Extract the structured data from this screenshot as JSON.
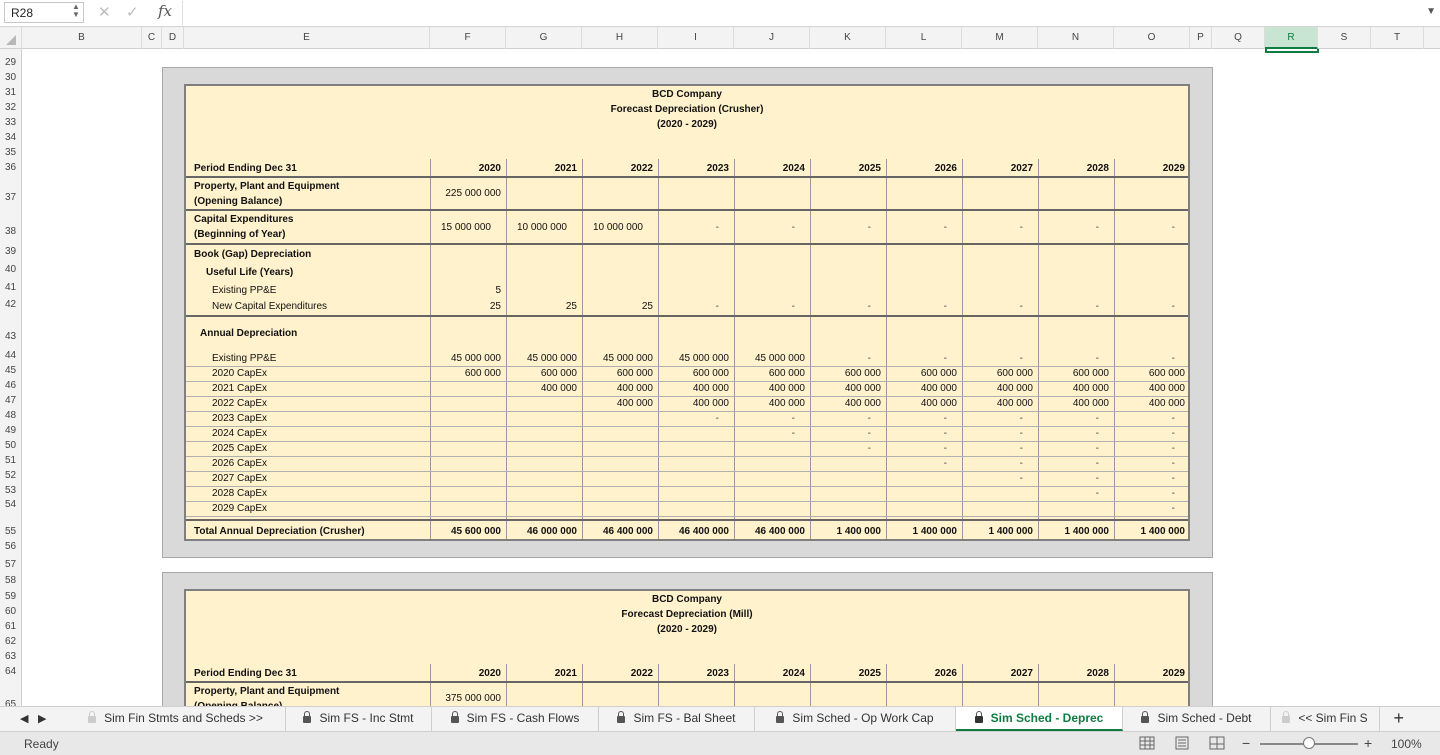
{
  "formula_bar": {
    "name_box": "R28",
    "fx_label": "fx",
    "cancel_icon": "✕",
    "enter_icon": "✓",
    "formula": ""
  },
  "columns": [
    "B",
    "C",
    "D",
    "E",
    "F",
    "G",
    "H",
    "I",
    "J",
    "K",
    "L",
    "M",
    "N",
    "O",
    "P",
    "Q",
    "R",
    "S",
    "T"
  ],
  "selected_column": "R",
  "rows": [
    "29",
    "30",
    "31",
    "32",
    "33",
    "34",
    "35",
    "36",
    "37",
    "38",
    "39",
    "40",
    "41",
    "42",
    "43",
    "44",
    "45",
    "46",
    "47",
    "48",
    "49",
    "50",
    "51",
    "52",
    "53",
    "54",
    "55",
    "56",
    "57",
    "58",
    "59",
    "60",
    "61",
    "62",
    "63",
    "64",
    "65"
  ],
  "crusher": {
    "company": "BCD Company",
    "title": "Forecast Depreciation (Crusher)",
    "period": "(2020 - 2029)",
    "period_label": "Period Ending Dec 31",
    "years": [
      "2020",
      "2021",
      "2022",
      "2023",
      "2024",
      "2025",
      "2026",
      "2027",
      "2028",
      "2029"
    ],
    "ppe_label_1": "Property, Plant and Equipment",
    "ppe_label_2": "(Opening Balance)",
    "ppe_value": "225 000 000",
    "capex_label_1": "Capital Expenditures",
    "capex_label_2": "(Beginning of Year)",
    "capex_values": [
      "15 000 000",
      "10 000 000",
      "10 000 000",
      "-",
      "-",
      "-",
      "-",
      "-",
      "-",
      "-"
    ],
    "book_dep_label": "Book (Gap) Depreciation",
    "useful_life_label": "Useful Life (Years)",
    "existing_ppe_label": "Existing PP&E",
    "existing_ppe_life": "5",
    "new_capex_label": "New Capital Expenditures",
    "new_capex_life": [
      "25",
      "25",
      "25",
      "-",
      "-",
      "-",
      "-",
      "-",
      "-",
      "-"
    ],
    "annual_dep_label": "Annual Depreciation",
    "dep_rows": [
      {
        "label": "Existing PP&E",
        "values": [
          "45 000 000",
          "45 000 000",
          "45 000 000",
          "45 000 000",
          "45 000 000",
          "-",
          "-",
          "-",
          "-",
          "-"
        ]
      },
      {
        "label": "2020 CapEx",
        "values": [
          "600 000",
          "600 000",
          "600 000",
          "600 000",
          "600 000",
          "600 000",
          "600 000",
          "600 000",
          "600 000",
          "600 000"
        ]
      },
      {
        "label": "2021 CapEx",
        "values": [
          "",
          "400 000",
          "400 000",
          "400 000",
          "400 000",
          "400 000",
          "400 000",
          "400 000",
          "400 000",
          "400 000"
        ]
      },
      {
        "label": "2022 CapEx",
        "values": [
          "",
          "",
          "400 000",
          "400 000",
          "400 000",
          "400 000",
          "400 000",
          "400 000",
          "400 000",
          "400 000"
        ]
      },
      {
        "label": "2023 CapEx",
        "values": [
          "",
          "",
          "",
          "-",
          "-",
          "-",
          "-",
          "-",
          "-",
          "-"
        ]
      },
      {
        "label": "2024 CapEx",
        "values": [
          "",
          "",
          "",
          "",
          "-",
          "-",
          "-",
          "-",
          "-",
          "-"
        ]
      },
      {
        "label": "2025 CapEx",
        "values": [
          "",
          "",
          "",
          "",
          "",
          "-",
          "-",
          "-",
          "-",
          "-"
        ]
      },
      {
        "label": "2026 CapEx",
        "values": [
          "",
          "",
          "",
          "",
          "",
          "",
          "-",
          "-",
          "-",
          "-"
        ]
      },
      {
        "label": "2027 CapEx",
        "values": [
          "",
          "",
          "",
          "",
          "",
          "",
          "",
          "-",
          "-",
          "-"
        ]
      },
      {
        "label": "2028 CapEx",
        "values": [
          "",
          "",
          "",
          "",
          "",
          "",
          "",
          "",
          "-",
          "-"
        ]
      },
      {
        "label": "2029 CapEx",
        "values": [
          "",
          "",
          "",
          "",
          "",
          "",
          "",
          "",
          "",
          "-"
        ]
      }
    ],
    "total_label": "Total Annual Depreciation (Crusher)",
    "total_values": [
      "45 600 000",
      "46 000 000",
      "46 400 000",
      "46 400 000",
      "46 400 000",
      "1 400 000",
      "1 400 000",
      "1 400 000",
      "1 400 000",
      "1 400 000"
    ]
  },
  "mill": {
    "company": "BCD Company",
    "title": "Forecast Depreciation (Mill)",
    "period": "(2020 - 2029)",
    "period_label": "Period Ending Dec 31",
    "years": [
      "2020",
      "2021",
      "2022",
      "2023",
      "2024",
      "2025",
      "2026",
      "2027",
      "2028",
      "2029"
    ],
    "ppe_label_1": "Property, Plant and Equipment",
    "ppe_label_2": "(Opening Balance)",
    "ppe_value": "375 000 000"
  },
  "tabs": [
    {
      "label": "Sim Fin Stmts and Scheds >>",
      "locked": true,
      "active": false
    },
    {
      "label": "Sim FS - Inc Stmt",
      "locked": true,
      "active": false
    },
    {
      "label": "Sim FS - Cash Flows",
      "locked": true,
      "active": false
    },
    {
      "label": "Sim FS - Bal Sheet",
      "locked": true,
      "active": false
    },
    {
      "label": "Sim Sched - Op Work Cap",
      "locked": true,
      "active": false
    },
    {
      "label": "Sim Sched - Deprec",
      "locked": true,
      "active": true
    },
    {
      "label": "Sim Sched - Debt",
      "locked": true,
      "active": false
    },
    {
      "label": "<< Sim Fin S",
      "locked": true,
      "active": false
    }
  ],
  "add_sheet": "+",
  "status": {
    "text": "Ready",
    "zoom": "100%",
    "zoom_level": 1.0,
    "zoom_minus": "−",
    "zoom_plus": "+"
  }
}
